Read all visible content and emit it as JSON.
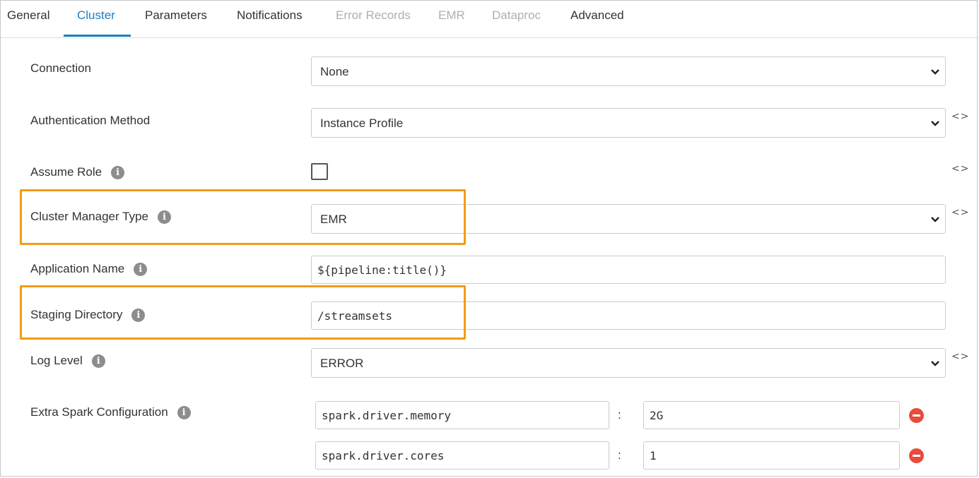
{
  "tabs": [
    {
      "label": "General",
      "state": "normal"
    },
    {
      "label": "Cluster",
      "state": "active"
    },
    {
      "label": "Parameters",
      "state": "normal"
    },
    {
      "label": "Notifications",
      "state": "normal"
    },
    {
      "label": "Error Records",
      "state": "disabled"
    },
    {
      "label": "EMR",
      "state": "disabled"
    },
    {
      "label": "Dataproc",
      "state": "disabled"
    },
    {
      "label": "Advanced",
      "state": "normal"
    }
  ],
  "form": {
    "connection": {
      "label": "Connection",
      "value": "None"
    },
    "auth_method": {
      "label": "Authentication Method",
      "value": "Instance Profile"
    },
    "assume_role": {
      "label": "Assume Role",
      "checked": false
    },
    "cluster_manager": {
      "label": "Cluster Manager Type",
      "value": "EMR"
    },
    "app_name": {
      "label": "Application Name",
      "value": "${pipeline:title()}"
    },
    "staging_dir": {
      "label": "Staging Directory",
      "value": "/streamsets"
    },
    "log_level": {
      "label": "Log Level",
      "value": "ERROR"
    },
    "extra_spark": {
      "label": "Extra Spark Configuration",
      "separator": ":",
      "rows": [
        {
          "key": "spark.driver.memory",
          "value": "2G"
        },
        {
          "key": "spark.driver.cores",
          "value": "1"
        }
      ]
    }
  },
  "icons": {
    "info": "i",
    "code_toggle": "<>"
  },
  "colors": {
    "accent": "#1a7fc1",
    "highlight": "#f39c12",
    "remove": "#e74c3c",
    "disabled_tab": "#aab0b7"
  }
}
